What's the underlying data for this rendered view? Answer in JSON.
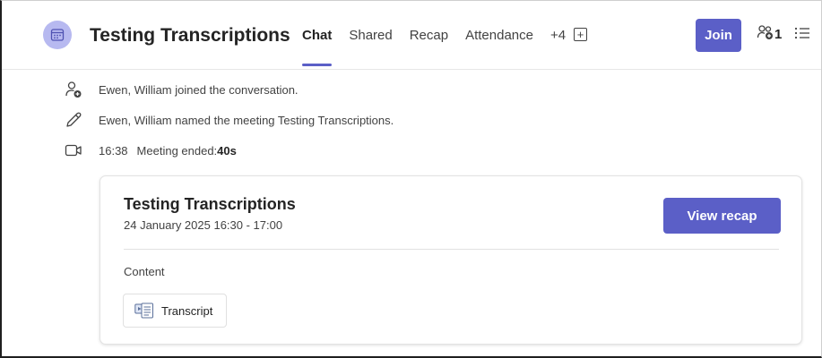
{
  "header": {
    "title": "Testing Transcriptions",
    "tabs": [
      "Chat",
      "Shared",
      "Recap",
      "Attendance"
    ],
    "more_tabs": "+4",
    "join_label": "Join",
    "participant_count": "1",
    "icons": {
      "meeting": "calendar-icon",
      "add_tab": "add-tab-icon",
      "participants": "people-add-icon",
      "list": "list-icon"
    }
  },
  "activity": [
    {
      "icon": "person-add-icon",
      "text": "Ewen, William joined the conversation."
    },
    {
      "icon": "pencil-icon",
      "text": "Ewen, William named the meeting Testing Transcriptions."
    },
    {
      "icon": "video-camera-icon",
      "time": "16:38",
      "text": "Meeting ended: ",
      "bold": "40s"
    }
  ],
  "card": {
    "title": "Testing Transcriptions",
    "datetime": "24 January 2025 16:30 - 17:00",
    "recap_label": "View recap",
    "content_label": "Content",
    "files": [
      {
        "icon": "transcript-file-icon",
        "name": "Transcript"
      }
    ]
  },
  "colors": {
    "accent": "#5b5fc7",
    "avatar_bg": "#b7b9f0"
  }
}
